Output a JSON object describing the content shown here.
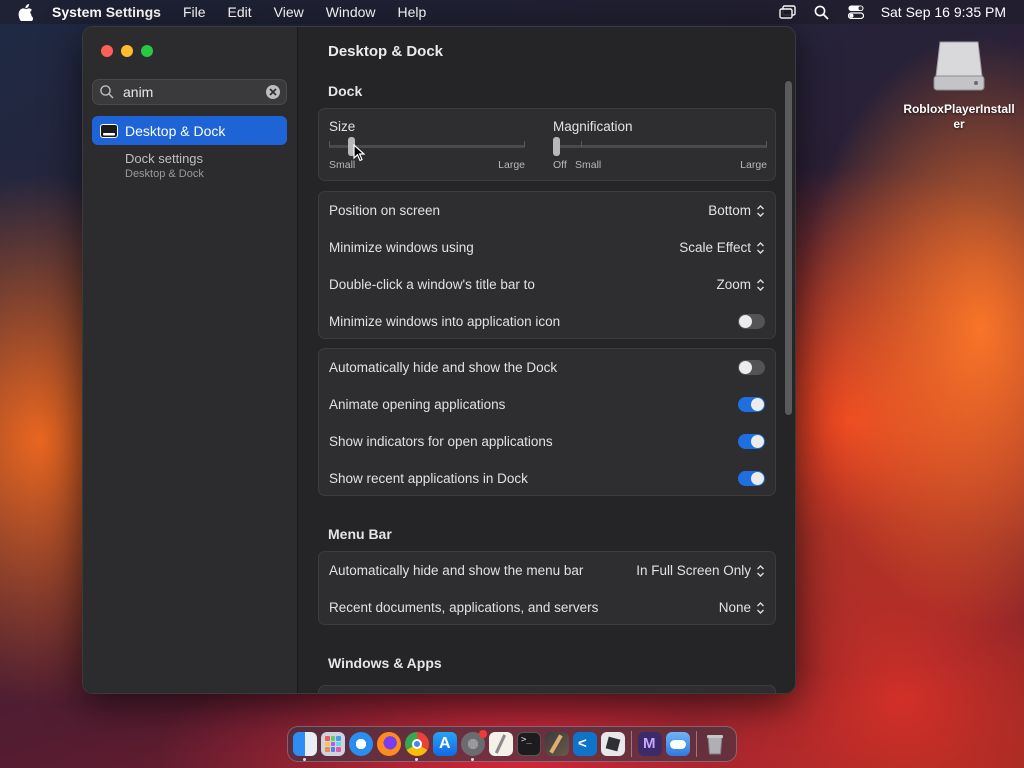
{
  "menubar": {
    "app_name": "System Settings",
    "items": [
      "File",
      "Edit",
      "View",
      "Window",
      "Help"
    ],
    "datetime": "Sat Sep 16  9:35 PM"
  },
  "desktop": {
    "icon_label": "RobloxPlayerInstaller"
  },
  "sidebar": {
    "search_value": "anim",
    "active_item": "Desktop & Dock",
    "sub_item_title": "Dock settings",
    "sub_item_path": "Desktop & Dock"
  },
  "content": {
    "title": "Desktop & Dock",
    "dock_section": "Dock",
    "size": {
      "label": "Size",
      "min_label": "Small",
      "max_label": "Large",
      "value_fraction": 0.11
    },
    "magnification": {
      "label": "Magnification",
      "off_label": "Off",
      "min_label": "Small",
      "max_label": "Large",
      "value_fraction": 0.0
    },
    "rows_group1": [
      {
        "label": "Position on screen",
        "value": "Bottom"
      },
      {
        "label": "Minimize windows using",
        "value": "Scale Effect"
      },
      {
        "label": "Double-click a window's title bar to",
        "value": "Zoom"
      },
      {
        "label": "Minimize windows into application icon",
        "toggle": false
      }
    ],
    "rows_group2": [
      {
        "label": "Automatically hide and show the Dock",
        "toggle": false
      },
      {
        "label": "Animate opening applications",
        "toggle": true
      },
      {
        "label": "Show indicators for open applications",
        "toggle": true
      },
      {
        "label": "Show recent applications in Dock",
        "toggle": true
      }
    ],
    "menubar_section": "Menu Bar",
    "rows_menubar": [
      {
        "label": "Automatically hide and show the menu bar",
        "value": "In Full Screen Only"
      },
      {
        "label": "Recent documents, applications, and servers",
        "value": "None"
      }
    ],
    "windows_section": "Windows & Apps"
  },
  "dock_apps": [
    "finder-icon",
    "launchpad-icon",
    "safari-icon",
    "firefox-icon",
    "chrome-icon",
    "app-store-icon",
    "system-settings-icon",
    "textedit-icon",
    "terminal-icon",
    "xcode-instruments-icon",
    "vscode-icon",
    "roblox-icon",
    "visual-studio-icon",
    "icloud-icon",
    "trash-icon"
  ],
  "colors": {
    "accent": "#1f64d6",
    "toggle_on": "#1f6fe0"
  }
}
